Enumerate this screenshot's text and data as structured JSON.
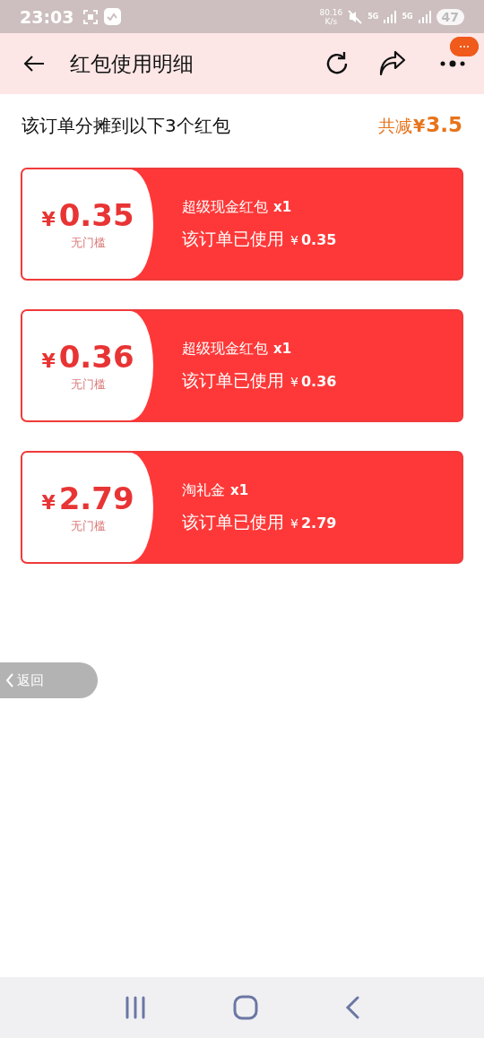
{
  "status_bar": {
    "time": "23:03",
    "net_speed": "80.16",
    "net_unit": "K/s",
    "sim_1": "5G",
    "sim_2": "5G",
    "battery": "47"
  },
  "header": {
    "title": "红包使用明细"
  },
  "summary": {
    "text": "该订单分摊到以下3个红包",
    "total_label": "共减",
    "total_currency": "¥",
    "total_amount": "3.5"
  },
  "red_packets": [
    {
      "currency": "¥",
      "amount": "0.35",
      "condition": "无门槛",
      "name": "超级现金红包",
      "count": "x1",
      "used_label": "该订单已使用",
      "used_currency": "¥",
      "used_amount": "0.35"
    },
    {
      "currency": "¥",
      "amount": "0.36",
      "condition": "无门槛",
      "name": "超级现金红包",
      "count": "x1",
      "used_label": "该订单已使用",
      "used_currency": "¥",
      "used_amount": "0.36"
    },
    {
      "currency": "¥",
      "amount": "2.79",
      "condition": "无门槛",
      "name": "淘礼金",
      "count": "x1",
      "used_label": "该订单已使用",
      "used_currency": "¥",
      "used_amount": "2.79"
    }
  ],
  "back_button": {
    "label": "返回"
  }
}
